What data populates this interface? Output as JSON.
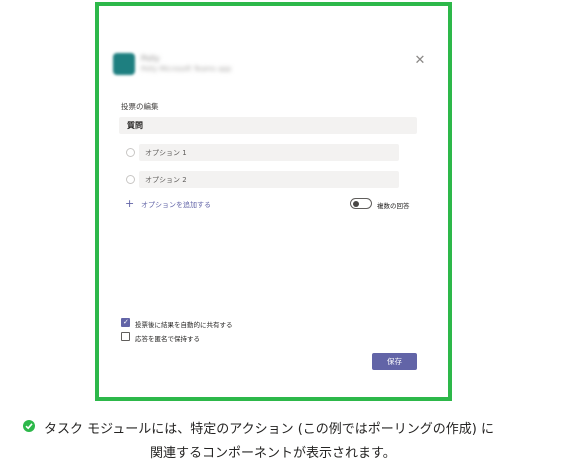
{
  "dialog": {
    "app_name": "Polly",
    "app_subtitle": "Polly Microsoft Teams app",
    "close_icon": "close-icon",
    "section_label": "投票の編集",
    "question_label": "質問",
    "options": [
      {
        "label": "オプション 1"
      },
      {
        "label": "オプション 2"
      }
    ],
    "add_option_label": "オプションを追加する",
    "multiple_answers_label": "複数の回答",
    "multiple_answers_enabled": false,
    "checkboxes": [
      {
        "label": "投票後に結果を自動的に共有する",
        "checked": true
      },
      {
        "label": "応答を匿名で保持する",
        "checked": false
      }
    ],
    "save_label": "保存"
  },
  "caption": {
    "line1": "タスク モジュールには、特定のアクション (この例ではポーリングの作成) に",
    "line2": "関連するコンポーネントが表示されます。"
  },
  "colors": {
    "frame": "#2db84a",
    "accent": "#6264a7",
    "field_bg": "#f3f2f1"
  }
}
